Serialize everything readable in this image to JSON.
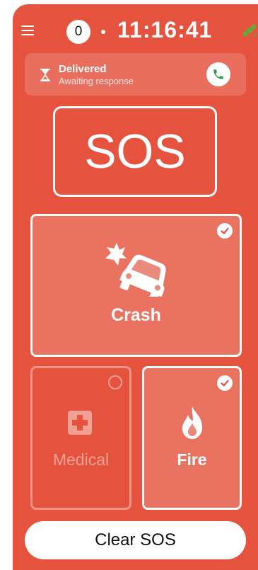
{
  "status_bar": {
    "badge_count": "0",
    "time": "11:16:41"
  },
  "banner": {
    "title": "Delivered",
    "subtitle": "Awaiting response"
  },
  "sos_label": "SOS",
  "tiles": [
    {
      "label": "Crash",
      "selected": true,
      "icon": "car-crash-icon"
    },
    {
      "label": "Medical",
      "selected": false,
      "icon": "medical-cross-icon"
    },
    {
      "label": "Fire",
      "selected": true,
      "icon": "fire-icon"
    }
  ],
  "clear_button": "Clear SOS",
  "colors": {
    "background": "#e5533f",
    "call_green": "#2e9e4a",
    "satellite_green": "#5fae3b"
  }
}
